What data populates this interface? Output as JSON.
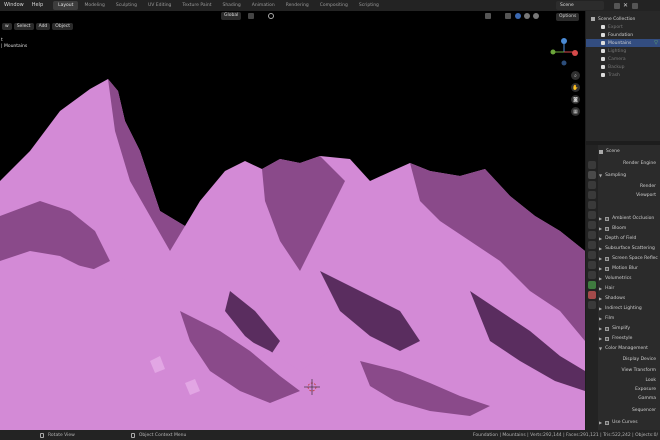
{
  "topbar": {
    "menus": [
      "Window",
      "Help"
    ],
    "workspaces": [
      "Layout",
      "Modeling",
      "Sculpting",
      "UV Editing",
      "Texture Paint",
      "Shading",
      "Animation",
      "Rendering",
      "Compositing",
      "Scripting"
    ],
    "active_workspace": "Layout",
    "scene": "Scene"
  },
  "viewport": {
    "orientation": "Global",
    "view_name": "t",
    "collection_label": "| Mountains",
    "options_label": "Options",
    "header_buttons": [
      "w",
      "Select",
      "Add",
      "Object"
    ],
    "terrain_color": "#d38ad6",
    "shadow_color": "#8a4a8a",
    "deep_shadow_color": "#5a2d5f"
  },
  "outliner": {
    "title": "Scene Collection",
    "items": [
      {
        "label": "Export",
        "dim": true
      },
      {
        "label": "Foundation",
        "dim": false
      },
      {
        "label": "Mountains",
        "dim": false,
        "selected": true
      },
      {
        "label": "Lighting",
        "dim": true
      },
      {
        "label": "Camera",
        "dim": true
      },
      {
        "label": "Backup",
        "dim": true
      },
      {
        "label": "Trash",
        "dim": true
      }
    ]
  },
  "properties": {
    "scene_label": "Scene",
    "render_engine_label": "Render Engine",
    "sampling_label": "Sampling",
    "render_label": "Render",
    "viewport_label": "Viewport",
    "sections": [
      {
        "label": "Ambient Occlusion",
        "checkbox": true
      },
      {
        "label": "Bloom",
        "checkbox": true
      },
      {
        "label": "Depth of Field",
        "checkbox": false
      },
      {
        "label": "Subsurface Scattering",
        "checkbox": false
      },
      {
        "label": "Screen Space Reflec",
        "checkbox": true
      },
      {
        "label": "Motion Blur",
        "checkbox": true
      },
      {
        "label": "Volumetrics",
        "checkbox": false
      },
      {
        "label": "Hair",
        "checkbox": false
      },
      {
        "label": "Shadows",
        "checkbox": false
      },
      {
        "label": "Indirect Lighting",
        "checkbox": false
      },
      {
        "label": "Film",
        "checkbox": false
      },
      {
        "label": "Simplify",
        "checkbox": true
      },
      {
        "label": "Freestyle",
        "checkbox": true
      },
      {
        "label": "Color Management",
        "checkbox": false
      }
    ],
    "color_mgmt": [
      "Display Device",
      "View Transform",
      "Look",
      "Exposure",
      "Gamma",
      "Sequencer"
    ],
    "use_curves": "Use Curves"
  },
  "statusbar": {
    "left": "Rotate View",
    "middle": "Object Context Menu",
    "right": "Foundation | Mountains | Verts:292,144 | Faces:291,121 | Tris:522,242 | Objects:0/"
  }
}
